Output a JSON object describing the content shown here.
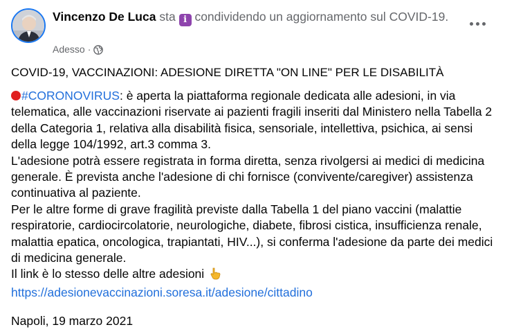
{
  "header": {
    "author": "Vincenzo De Luca",
    "action_prefix": "sta",
    "info_symbol": "i",
    "action_text": "condividendo un aggiornamento sul COVID-19.",
    "time": "Adesso",
    "separator": "·",
    "audience_icon": "globe-icon",
    "more_icon": "more-options-icon"
  },
  "post": {
    "title": "COVID-19, VACCINAZIONI: ADESIONE DIRETTA \"ON LINE\" PER LE DISABILITÀ",
    "hashtag": "#CORONOVIRUS",
    "p1_text": ": è aperta la piattaforma regionale dedicata alle adesioni, in via telematica, alle vaccinazioni riservate ai pazienti fragili inseriti dal Ministero nella Tabella 2 della Categoria 1, relativa alla disabilità fisica, sensoriale, intellettiva, psichica, ai sensi della legge 104/1992, art.3 comma 3.",
    "p2": "L'adesione potrà essere registrata in forma diretta, senza rivolgersi ai medici di medicina generale. È prevista anche l'adesione di chi fornisce (convivente/caregiver) assistenza continuativa al paziente.",
    "p3": "Per le altre forme di grave fragilità previste dalla Tabella 1 del piano vaccini (malattie respiratorie, cardiocircolatorie, neurologiche, diabete, fibrosi cistica, insufficienza renale, malattia epatica, oncologica, trapiantati, HIV...), si conferma l'adesione da parte dei medici di medicina generale.",
    "p4": "Il link è lo stesso delle altre adesioni",
    "link": "https://adesionevaccinazioni.soresa.it/adesione/cittadino",
    "date": "Napoli, 19 marzo 2021"
  },
  "colors": {
    "link": "#216fdb",
    "secondary_text": "#65676b",
    "info_emoji": "#8e44ad"
  }
}
